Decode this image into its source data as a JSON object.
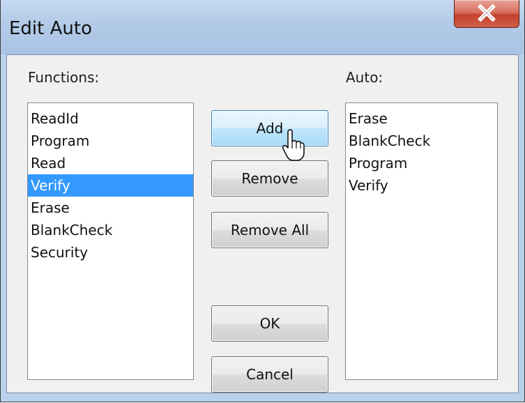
{
  "window": {
    "title": "Edit Auto",
    "close_icon": "close-x-icon"
  },
  "functions": {
    "label": "Functions:",
    "items": [
      "ReadId",
      "Program",
      "Read",
      "Verify",
      "Erase",
      "BlankCheck",
      "Security"
    ],
    "selected": "Verify"
  },
  "buttons": {
    "add": "Add",
    "remove": "Remove",
    "remove_all": "Remove All",
    "ok": "OK",
    "cancel": "Cancel"
  },
  "auto": {
    "label": "Auto:",
    "items": [
      "Erase",
      "BlankCheck",
      "Program",
      "Verify"
    ]
  },
  "colors": {
    "selection": "#3399ff",
    "close_button": "#c4422d",
    "hover_button": "#bee6fd"
  }
}
